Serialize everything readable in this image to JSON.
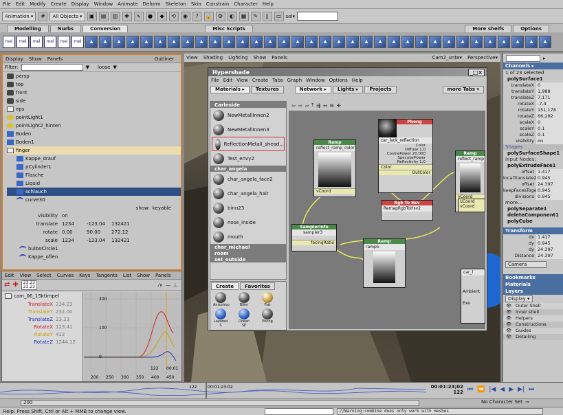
{
  "menubar": [
    "File",
    "Edit",
    "Modify",
    "Create",
    "Display",
    "Window",
    "Animate",
    "Deform",
    "Skeleton",
    "Skin",
    "Constrain",
    "Character",
    "Help"
  ],
  "statusline": {
    "mode": "Animation",
    "objects": "All Objects",
    "sel_label": "sel▾"
  },
  "shelf_tabs": [
    "Modelling",
    "Nurbs",
    "Conversion",
    "Misc Scripts"
  ],
  "shelf_right": {
    "more": "More shelfs",
    "options": "Options"
  },
  "shelf_icons": [
    "mel",
    "mel",
    "mel",
    "mel",
    "mel",
    "mel"
  ],
  "outliner": {
    "menu": [
      "Display",
      "Show",
      "Panels"
    ],
    "title": "Outliner",
    "filter_label": "Filter:",
    "filter_mode": "loose",
    "items": [
      {
        "label": "persp",
        "icon": "cam"
      },
      {
        "label": "top",
        "icon": "cam"
      },
      {
        "label": "front",
        "icon": "cam"
      },
      {
        "label": "side",
        "icon": "cam"
      },
      {
        "label": "eps",
        "icon": "grp"
      },
      {
        "label": "pointLight1",
        "icon": "light"
      },
      {
        "label": "pointLight2_hinten",
        "icon": "light"
      },
      {
        "label": "Boden",
        "icon": "mesh"
      },
      {
        "label": "Boden1",
        "icon": "mesh"
      },
      {
        "label": "finger",
        "icon": "grp",
        "hl": true
      },
      {
        "label": "Kappe_drauf",
        "icon": "mesh"
      },
      {
        "label": "pCylinder1",
        "icon": "mesh"
      },
      {
        "label": "Flasche",
        "icon": "mesh"
      },
      {
        "label": "Liquid",
        "icon": "mesh"
      },
      {
        "label": "schlauch",
        "icon": "mesh",
        "sel": true
      },
      {
        "label": "curve30",
        "icon": "curve"
      }
    ],
    "show_label": "show:",
    "show_value": "keyable",
    "attrs": [
      {
        "name": "visibility",
        "v": [
          "on",
          "",
          ""
        ]
      },
      {
        "name": "translate",
        "v": [
          "1234",
          "-123.04",
          "132421"
        ]
      },
      {
        "name": "rotate",
        "v": [
          "0.00",
          "90.00",
          "272.12"
        ]
      },
      {
        "name": "scale",
        "v": [
          "1234",
          "-123.04",
          "132421"
        ]
      }
    ],
    "tail": [
      "bulboCircle1",
      "Kappe_offen"
    ]
  },
  "graph": {
    "menu": [
      "Edit",
      "View",
      "Select",
      "Curves",
      "Keys",
      "Tangents",
      "List",
      "Show",
      "Panels"
    ],
    "values": [
      "23.23",
      "23.23"
    ],
    "camera": "cam_06_15ktimpel",
    "channels": [
      {
        "name": "TranslateX",
        "val": "234.23",
        "color": "#d02020"
      },
      {
        "name": "TranslateY",
        "val": "232.00",
        "color": "#c8a000"
      },
      {
        "name": "TranslateZ",
        "val": "23.23",
        "color": "#2030c0"
      },
      {
        "name": "RotateX",
        "val": "123.41",
        "color": "#d02020"
      },
      {
        "name": "RotateY",
        "val": "412",
        "color": "#c8a000"
      },
      {
        "name": "RotateZ",
        "val": "1244.12",
        "color": "#2030c0"
      }
    ],
    "y_labels": [
      "200",
      "100",
      "0"
    ],
    "x_labels": [
      "200",
      "250",
      "300",
      "350",
      "400",
      "450",
      "500"
    ],
    "frame": "122",
    "time": "00:01"
  },
  "viewport": {
    "menu": [
      "View",
      "Shading",
      "Lighting",
      "Show",
      "Panels"
    ],
    "camera": "Cam2_unte▾",
    "persp": "Perspective▾"
  },
  "hypershade": {
    "title": "Hypershade",
    "menu": [
      "File",
      "Edit",
      "View",
      "Create",
      "Tabs",
      "Graph",
      "Window",
      "Options",
      "Help"
    ],
    "tabs": [
      "Materials",
      "Textures",
      "Network",
      "Lights",
      "Projects"
    ],
    "more_tabs": "more Tabs ▾",
    "section1": "Carlnside",
    "mats1": [
      "NewMetallInnen2",
      "NewMetallInnen3",
      "ReflectionMetall_shead...",
      "Test_envy2"
    ],
    "section2": "char_angela",
    "mats2": [
      "char_angela_face2",
      "char_angela_hair",
      "binn23",
      "nose_inside",
      "mouth"
    ],
    "section3": "char_michael",
    "section4": "room",
    "section5": "set_outside",
    "create_tabs": [
      "Create",
      "Favorites"
    ],
    "create_items": [
      "Anisotrop",
      "Blinn",
      "Flat",
      "Layered S",
      "Ocean SE",
      "Phong"
    ],
    "nodes": {
      "ramp1": {
        "type": "Ramp",
        "name": "reflect_ramp_color",
        "out": "vCoord"
      },
      "phong": {
        "type": "Phong",
        "name": "car_lack_reflection",
        "attrs": [
          "Color",
          "Diffuse 1.0",
          "CosinePower 20.000",
          "SpecularPower",
          "Reflectivity 1.0"
        ],
        "out1": "Color",
        "out2": "OutColor"
      },
      "ramp2": {
        "type": "Ramp",
        "name": "reflect_ramp",
        "out": "vCoord"
      },
      "rgb": {
        "type": "Rgb To Hsv",
        "name": "RemapRgbToHsv2",
        "o1": "uCoord",
        "o2": "vCoord"
      },
      "sampler": {
        "type": "SamplerInfo",
        "name": "sampler3",
        "out": "facingRatio"
      },
      "ramp5": {
        "type": "Ramp",
        "name": "ramp5"
      },
      "car": {
        "name": "car_l",
        "a": "Ambient",
        "b": "Exe"
      }
    }
  },
  "channelbox": {
    "title": "Channels ▸",
    "selected": "1 of 23 selected",
    "obj": "polySurface1",
    "attrs": [
      [
        "translateX",
        "0"
      ],
      [
        "translateY",
        "1,988"
      ],
      [
        "translateZ",
        "7,171"
      ],
      [
        "rotateX",
        "-7,4"
      ],
      [
        "rotateY",
        "151,178"
      ],
      [
        "rotateZ",
        "66,282"
      ],
      [
        "scaleX",
        "0"
      ],
      [
        "scaleY",
        "0.1"
      ],
      [
        "scaleZ",
        "0.1"
      ],
      [
        "visibility",
        "on"
      ]
    ],
    "shapes_label": "Shapes",
    "shape": "polySurfaceShape1",
    "inputs_label": "Input Nodes:",
    "input1": "polyExtrudeFace1",
    "inputattrs": [
      [
        "offset",
        "1.417"
      ],
      [
        "localTranslateZ",
        "0.945"
      ],
      [
        "offset",
        "24.397"
      ],
      [
        "keepFacesToge",
        "0.945"
      ],
      [
        "divisions",
        "0.945"
      ]
    ],
    "more": "more...",
    "others": [
      "polySeparate1",
      "deleteComponent1",
      "polyCube"
    ],
    "transform": "Transform",
    "tattrs": [
      [
        "dx",
        "1.417"
      ],
      [
        "dy",
        "0.945"
      ],
      [
        "dy",
        "24.397"
      ],
      [
        "Distance",
        "24.397"
      ]
    ],
    "camera": "Camera",
    "bookmarks": "Bookmarks",
    "materials": "Materials",
    "layers": "Layers",
    "display": "Display",
    "layerlist": [
      "Outer Shell",
      "Inner shell",
      "Helpers",
      "Constructions",
      "Guides",
      "Detailing"
    ]
  },
  "timeline": {
    "ticks": [
      "122",
      "00:01:23:02"
    ],
    "current": "00:01:23;02",
    "frame": "122",
    "start": "200",
    "charset": "No Character Set"
  },
  "help": "Help: Press Shift, Ctrl or Alt + MMB to change view.",
  "script": "//Warning:combine does only work with meshes"
}
